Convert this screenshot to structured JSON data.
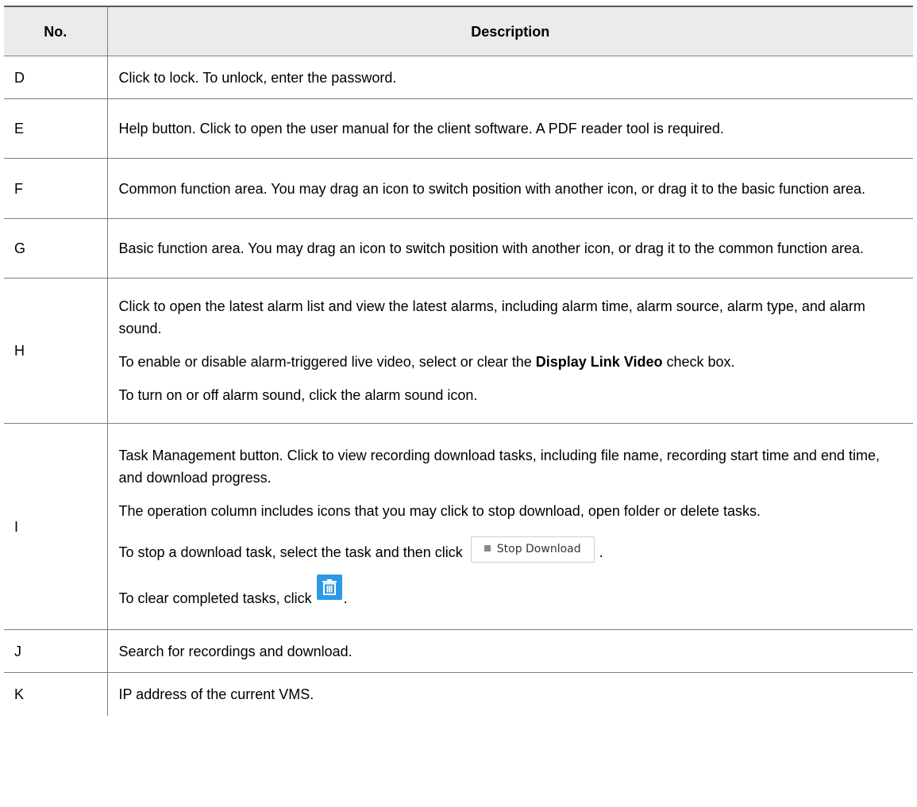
{
  "table": {
    "headers": {
      "no": "No.",
      "description": "Description"
    },
    "rows": [
      {
        "no": "D",
        "paragraphs": [
          "Click to lock. To unlock, enter the password."
        ]
      },
      {
        "no": "E",
        "paragraphs": [
          "Help button. Click to open the user manual for the client software. A PDF reader tool is required."
        ]
      },
      {
        "no": "F",
        "paragraphs": [
          "Common function area. You may drag an icon to switch position with another icon, or drag it to the basic function area."
        ]
      },
      {
        "no": "G",
        "paragraphs": [
          "Basic function area. You may drag an icon to switch position with another icon, or drag it to the common function area."
        ]
      },
      {
        "no": "H",
        "paragraphs": [
          "Click to open the latest alarm list and view the latest alarms, including alarm time, alarm source, alarm type, and alarm sound.",
          {
            "before": "To enable or disable alarm-triggered live video, select or clear the ",
            "bold": "Display Link Video",
            "after": " check box."
          },
          "To turn on or off alarm sound, click the alarm sound icon."
        ]
      },
      {
        "no": "I",
        "paragraphs": [
          "Task Management button. Click to view recording download tasks, including file name, recording start time and end time, and download progress.",
          "The operation column includes icons that you may click to stop download, open folder or delete tasks.",
          {
            "before": "To stop a download task, select the task and then click",
            "button_label": "Stop Download",
            "after": "."
          },
          {
            "before": "To clear completed tasks, click",
            "icon": "trash-icon",
            "after": "."
          }
        ]
      },
      {
        "no": "J",
        "paragraphs": [
          "Search for recordings and download."
        ]
      },
      {
        "no": "K",
        "paragraphs": [
          "IP address of the current VMS."
        ]
      }
    ]
  },
  "colors": {
    "header_bg": "#ebebeb",
    "border": "#7f7f7f",
    "clear_button_bg": "#2d9ae8",
    "stop_icon": "#8a8a8a"
  }
}
